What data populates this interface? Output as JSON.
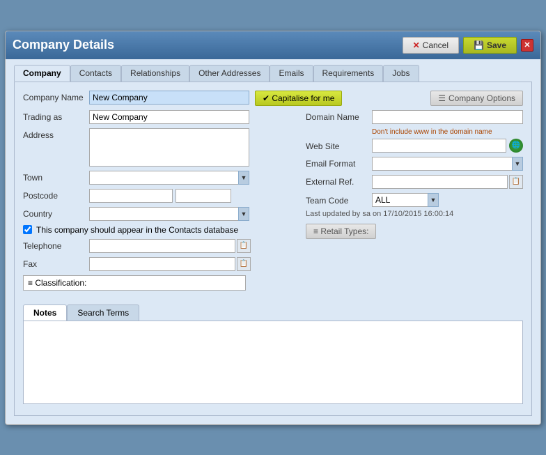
{
  "window": {
    "title": "Company Details",
    "close_label": "✕"
  },
  "header": {
    "cancel_label": "Cancel",
    "save_label": "Save",
    "cancel_icon": "✕",
    "save_icon": "💾"
  },
  "tabs": {
    "main": [
      "Company",
      "Contacts",
      "Relationships",
      "Other Addresses",
      "Emails",
      "Requirements",
      "Jobs"
    ],
    "active_main": "Company",
    "bottom": [
      "Notes",
      "Search Terms"
    ],
    "active_bottom": "Notes"
  },
  "form": {
    "company_name_label": "Company Name",
    "company_name_value": "New Company",
    "capitalise_label": "✔ Capitalise for me",
    "company_options_label": "Company Options",
    "trading_as_label": "Trading as",
    "trading_as_value": "New Company",
    "address_label": "Address",
    "address_value": "",
    "town_label": "Town",
    "postcode_label": "Postcode",
    "country_label": "Country",
    "checkbox_label": "This company should appear in the Contacts database",
    "telephone_label": "Telephone",
    "telephone_value": "",
    "fax_label": "Fax",
    "fax_value": "",
    "classification_label": "≡ Classification:",
    "domain_name_label": "Domain Name",
    "domain_name_value": "",
    "domain_hint": "Don't include www in the domain name",
    "website_label": "Web Site",
    "website_value": "",
    "email_format_label": "Email Format",
    "email_format_value": "",
    "external_ref_label": "External Ref.",
    "external_ref_value": "",
    "team_code_label": "Team Code",
    "team_code_value": "ALL",
    "last_updated": "Last updated by sa on 17/10/2015 16:00:14",
    "retail_types_label": "≡ Retail Types:"
  }
}
